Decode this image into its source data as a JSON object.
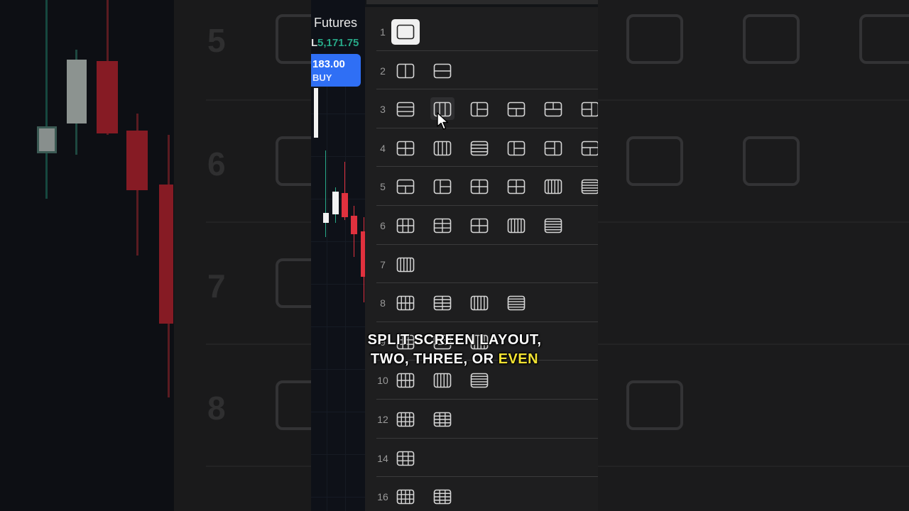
{
  "chart": {
    "title": "Futures",
    "price_prefix": "L",
    "last_price": "5,171.75",
    "buy_price": "183.00",
    "buy_label": "BUY"
  },
  "layout_picker": {
    "rows": [
      {
        "label": "1",
        "icons": [
          "single-pane-icon"
        ]
      },
      {
        "label": "2",
        "icons": [
          "two-columns-icon",
          "two-rows-icon"
        ]
      },
      {
        "label": "3",
        "icons": [
          "three-rows-icon",
          "three-columns-icon",
          "left-plus-two-right-icon",
          "top-plus-two-bottom-icon",
          "two-top-plus-bottom-icon",
          "two-left-plus-right-icon"
        ]
      },
      {
        "label": "4",
        "icons": [
          "grid-2x2-icon",
          "four-columns-icon",
          "four-rows-icon",
          "left-plus-three-right-icon",
          "three-left-plus-right-icon",
          "top-plus-three-bottom-icon"
        ]
      },
      {
        "label": "5",
        "icons": [
          "top-plus-four-bottom-icon",
          "left-plus-four-right-icon",
          "five-grid-a-icon",
          "five-grid-b-icon",
          "five-columns-icon",
          "five-rows-icon"
        ]
      },
      {
        "label": "6",
        "icons": [
          "grid-3x2-icon",
          "grid-2x3-icon",
          "six-grid-icon",
          "six-columns-icon",
          "six-rows-icon"
        ]
      },
      {
        "label": "7",
        "icons": [
          "seven-columns-icon"
        ]
      },
      {
        "label": "8",
        "icons": [
          "grid-4x2-icon",
          "grid-2x4-icon",
          "eight-columns-icon",
          "eight-rows-icon"
        ]
      },
      {
        "label": "9",
        "icons": [
          "grid-3x3-icon",
          "nine-rows-icon",
          "nine-columns-icon"
        ]
      },
      {
        "label": "10",
        "icons": [
          "grid-5x2-icon",
          "ten-columns-icon",
          "ten-rows-icon"
        ]
      },
      {
        "label": "12",
        "icons": [
          "grid-4x3-icon",
          "grid-3x4-icon"
        ]
      },
      {
        "label": "14",
        "icons": [
          "grid-14-icon"
        ]
      },
      {
        "label": "16",
        "icons": [
          "grid-16a-icon",
          "grid-4x4-icon"
        ]
      }
    ],
    "selected_row": "1",
    "hovered_icon": "three-columns-icon"
  },
  "caption": {
    "line1": "SPLIT SCREEN LAYOUT,",
    "line2_prefix": "TWO, THREE, OR ",
    "line2_highlight": "EVEN"
  },
  "colors": {
    "buy": "#2f6ff5",
    "price_up": "#27a887",
    "candle_down": "#e0313e",
    "caption_highlight": "#f1e233"
  }
}
